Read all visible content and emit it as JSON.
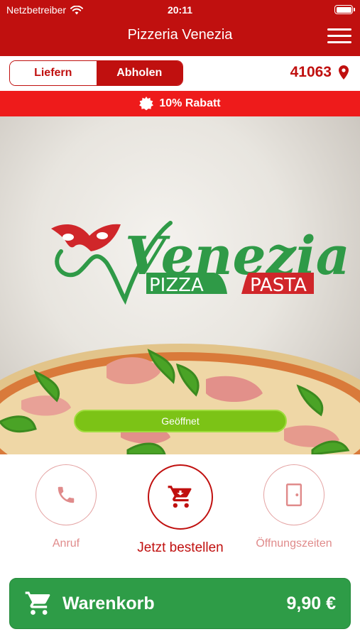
{
  "status_bar": {
    "carrier": "Netzbetreiber",
    "time": "20:11"
  },
  "header": {
    "title": "Pizzeria Venezia"
  },
  "delivery_mode": {
    "options": [
      "Liefern",
      "Abholen"
    ],
    "selected": "Abholen"
  },
  "location": {
    "zip": "41063"
  },
  "banner": {
    "text": "10% Rabatt"
  },
  "hero": {
    "logo_text": "Venezia",
    "logo_pizza": "PIZZA",
    "logo_pasta": "PASTA",
    "status_button": "Geöffnet"
  },
  "actions": {
    "call_label": "Anruf",
    "order_label": "Jetzt bestellen",
    "hours_label": "Öffnungszeiten"
  },
  "cart": {
    "label": "Warenkorb",
    "price": "9,90 €"
  },
  "colors": {
    "brand_red": "#c0100f",
    "banner_red": "#ee1b1b",
    "open_green": "#7cc316",
    "cart_green": "#2e9c47",
    "logo_green": "#2f9a47",
    "logo_red": "#d0262a"
  }
}
